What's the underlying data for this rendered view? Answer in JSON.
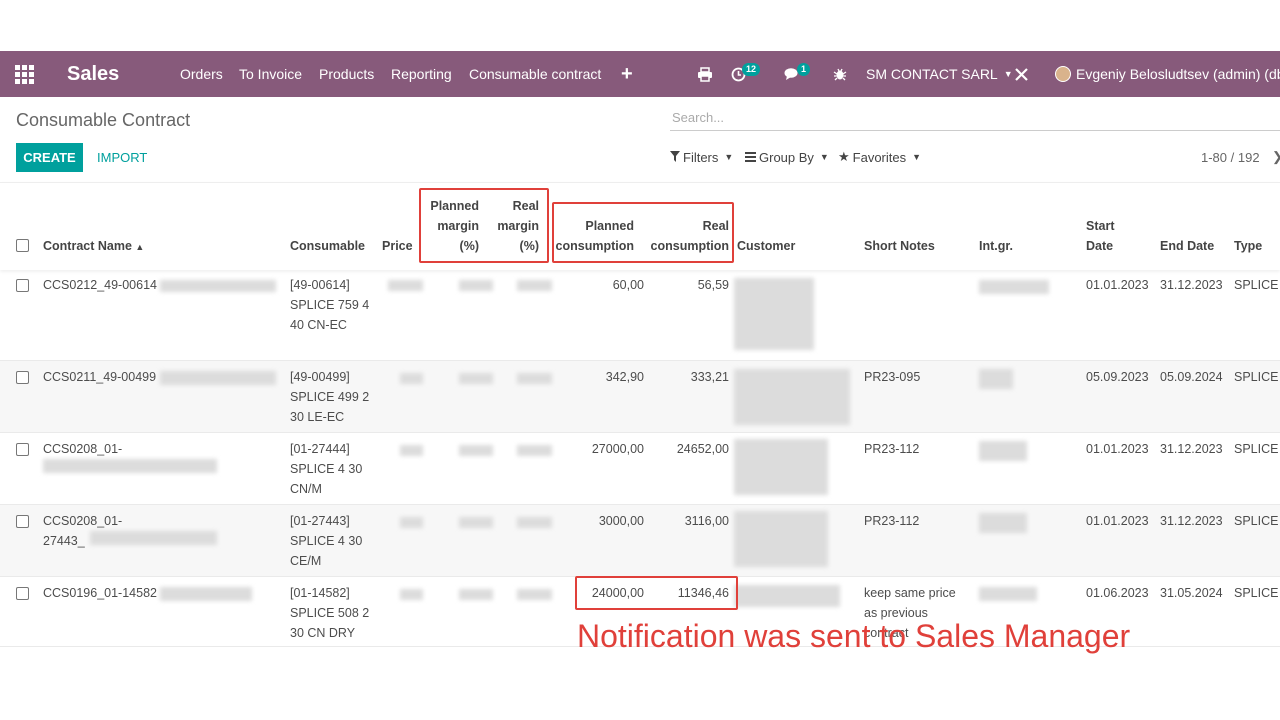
{
  "navbar": {
    "app_name": "Sales",
    "menu": [
      "Orders",
      "To Invoice",
      "Products",
      "Reporting",
      "Consumable contract"
    ],
    "add_icon": "+",
    "activity_count": "12",
    "messages_count": "1",
    "company": "SM CONTACT SARL",
    "user": "Evgeniy Belosludtsev (admin) (db_c"
  },
  "control_panel": {
    "breadcrumb": "Consumable Contract",
    "search_placeholder": "Search...",
    "create_label": "CREATE",
    "import_label": "IMPORT",
    "filters_label": "Filters",
    "groupby_label": "Group By",
    "favorites_label": "Favorites",
    "pager": "1-80 / 192"
  },
  "table": {
    "headers": {
      "contract_name": "Contract Name",
      "consumable": "Consumable",
      "price": "Price",
      "planned_margin": [
        "Planned",
        "margin",
        "(%)"
      ],
      "real_margin": [
        "Real",
        "margin",
        "(%)"
      ],
      "planned_consumption": [
        "Planned",
        "consumption"
      ],
      "real_consumption": [
        "Real",
        "consumption"
      ],
      "customer": "Customer",
      "short_notes": "Short Notes",
      "int_gr": "Int.gr.",
      "start_date": [
        "Start",
        "Date"
      ],
      "end_date": "End Date",
      "type": "Type"
    },
    "rows": [
      {
        "name": [
          "CCS0212_49-00614"
        ],
        "consumable": [
          "[49-00614]",
          "SPLICE 759 4",
          "40 CN-EC"
        ],
        "planned": "60,00",
        "real": "56,59",
        "notes": [],
        "start": "01.01.2023",
        "end": "31.12.2023",
        "type": "SPLICE"
      },
      {
        "name": [
          "CCS0211_49-00499"
        ],
        "consumable": [
          "[49-00499]",
          "SPLICE 499 2",
          "30 LE-EC"
        ],
        "planned": "342,90",
        "real": "333,21",
        "notes": [
          "PR23-095"
        ],
        "start": "05.09.2023",
        "end": "05.09.2024",
        "type": "SPLICE"
      },
      {
        "name": [
          "CCS0208_01-"
        ],
        "consumable": [
          "[01-27444]",
          "SPLICE 4 30",
          "CN/M"
        ],
        "planned": "27000,00",
        "real": "24652,00",
        "notes": [
          "PR23-112"
        ],
        "start": "01.01.2023",
        "end": "31.12.2023",
        "type": "SPLICE"
      },
      {
        "name": [
          "CCS0208_01-",
          "27443_"
        ],
        "consumable": [
          "[01-27443]",
          "SPLICE 4 30",
          "CE/M"
        ],
        "planned": "3000,00",
        "real": "3116,00",
        "notes": [
          "PR23-112"
        ],
        "start": "01.01.2023",
        "end": "31.12.2023",
        "type": "SPLICE"
      },
      {
        "name": [
          "CCS0196_01-14582"
        ],
        "consumable": [
          "[01-14582]",
          "SPLICE 508 2",
          "30 CN DRY"
        ],
        "planned": "24000,00",
        "real": "11346,46",
        "notes": [
          "keep same price",
          "as previous",
          "contract"
        ],
        "start": "01.06.2023",
        "end": "31.05.2024",
        "type": "SPLICE"
      }
    ]
  },
  "annotation": "Notification was sent to Sales Manager",
  "colors": {
    "navbar": "#875a7b",
    "primary": "#00a09d",
    "highlight": "#e0403a"
  }
}
